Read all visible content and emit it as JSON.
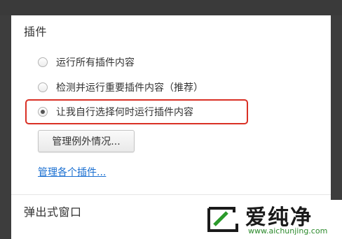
{
  "plugins_section": {
    "title": "插件",
    "options": [
      {
        "label": "运行所有插件内容",
        "checked": false
      },
      {
        "label": "检测并运行重要插件内容（推荐）",
        "checked": false
      },
      {
        "label": "让我自行选择何时运行插件内容",
        "checked": true
      }
    ],
    "manage_exceptions_label": "管理例外情况...",
    "manage_plugins_link": "管理各个插件..."
  },
  "popups_section": {
    "title": "弹出式窗口"
  },
  "watermark": {
    "brand_text": "爱纯净",
    "url": "www.aichunjing.com"
  },
  "colors": {
    "highlight_border": "#d93025",
    "link": "#1a6fd1",
    "background": "#3d3d3d"
  }
}
